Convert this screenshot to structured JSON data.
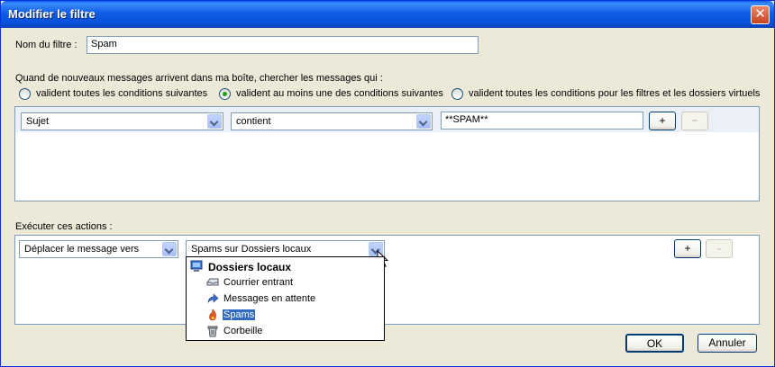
{
  "window": {
    "title": "Modifier le filtre",
    "close": "✕"
  },
  "filter_name": {
    "label": "Nom du filtre :",
    "value": "Spam"
  },
  "match": {
    "prompt": "Quand de nouveaux messages arrivent dans ma boîte, chercher les messages qui :",
    "options": [
      {
        "label": "valident toutes les conditions suivantes",
        "checked": false
      },
      {
        "label": "valident au moins une des conditions suivantes",
        "checked": true
      },
      {
        "label": "valident toutes les conditions pour les filtres et les dossiers virtuels",
        "checked": false
      }
    ]
  },
  "condition": {
    "field": "Sujet",
    "operator": "contient",
    "value": "**SPAM**",
    "add": "+",
    "remove": "−"
  },
  "actions": {
    "label": "Exécuter ces actions :",
    "action": "Déplacer le message vers",
    "target": "Spams sur Dossiers locaux",
    "add": "+",
    "remove": "-"
  },
  "folder_menu": {
    "root": {
      "label": "Dossiers locaux",
      "icon": "computer-icon"
    },
    "items": [
      {
        "label": "Courrier entrant",
        "icon": "inbox-icon"
      },
      {
        "label": "Messages en attente",
        "icon": "arrow-icon"
      },
      {
        "label": "Spams",
        "icon": "flame-icon",
        "selected": true
      },
      {
        "label": "Corbeille",
        "icon": "trash-icon"
      }
    ]
  },
  "buttons": {
    "ok": "OK",
    "cancel": "Annuler"
  },
  "colors": {
    "titlebar": "#0a5ef0",
    "selection": "#316ac5",
    "dialog_bg": "#ece9d8"
  }
}
